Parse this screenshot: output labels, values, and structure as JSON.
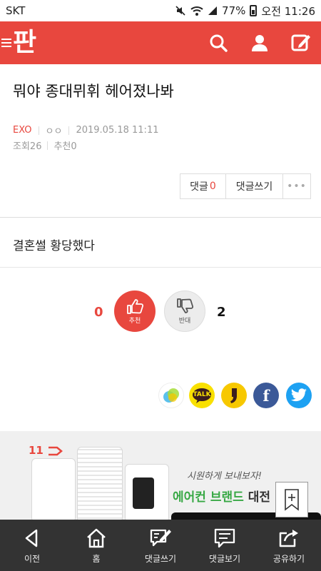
{
  "statusbar": {
    "carrier": "SKT",
    "battery": "77%",
    "time": "오전 11:26"
  },
  "appbar": {
    "logo": "판",
    "icons": [
      "menu-icon",
      "search-icon",
      "user-icon",
      "edit-icon"
    ]
  },
  "article": {
    "title": "뭐야 종대뮈휘 헤어졌나봐",
    "category": "EXO",
    "author": "ㅇㅇ",
    "date": "2019.05.18 11:11",
    "views": "조회26",
    "recommend": "추천0",
    "body": "결혼썰 황당했다"
  },
  "actions": {
    "comments_label": "댓글",
    "comments_count": "0",
    "write_comment": "댓글쓰기",
    "more": "•••"
  },
  "votes": {
    "up_count": "0",
    "up_label": "추천",
    "down_label": "반대",
    "down_count": "2"
  },
  "share": [
    "band-icon",
    "kakaotalk-icon",
    "kakaostory-icon",
    "facebook-icon",
    "twitter-icon"
  ],
  "share_labels": {
    "talk": "TALK",
    "facebook": "f"
  },
  "ad": {
    "brand": "11",
    "slogan": "시원하게 보내보자!",
    "headline_green": "에어컨 브랜드",
    "headline_dark": "대전"
  },
  "bottom_nav": [
    {
      "label": "이전",
      "icon": "back-icon"
    },
    {
      "label": "홈",
      "icon": "home-icon"
    },
    {
      "label": "댓글쓰기",
      "icon": "write-comment-icon"
    },
    {
      "label": "댓글보기",
      "icon": "view-comments-icon"
    },
    {
      "label": "공유하기",
      "icon": "share-icon"
    }
  ],
  "colors": {
    "brand": "#e8473e",
    "bottom_bar": "#333333",
    "kakao": "#f9e000",
    "facebook": "#3b5998",
    "twitter": "#1da1f2",
    "ad_green": "#37a844"
  }
}
